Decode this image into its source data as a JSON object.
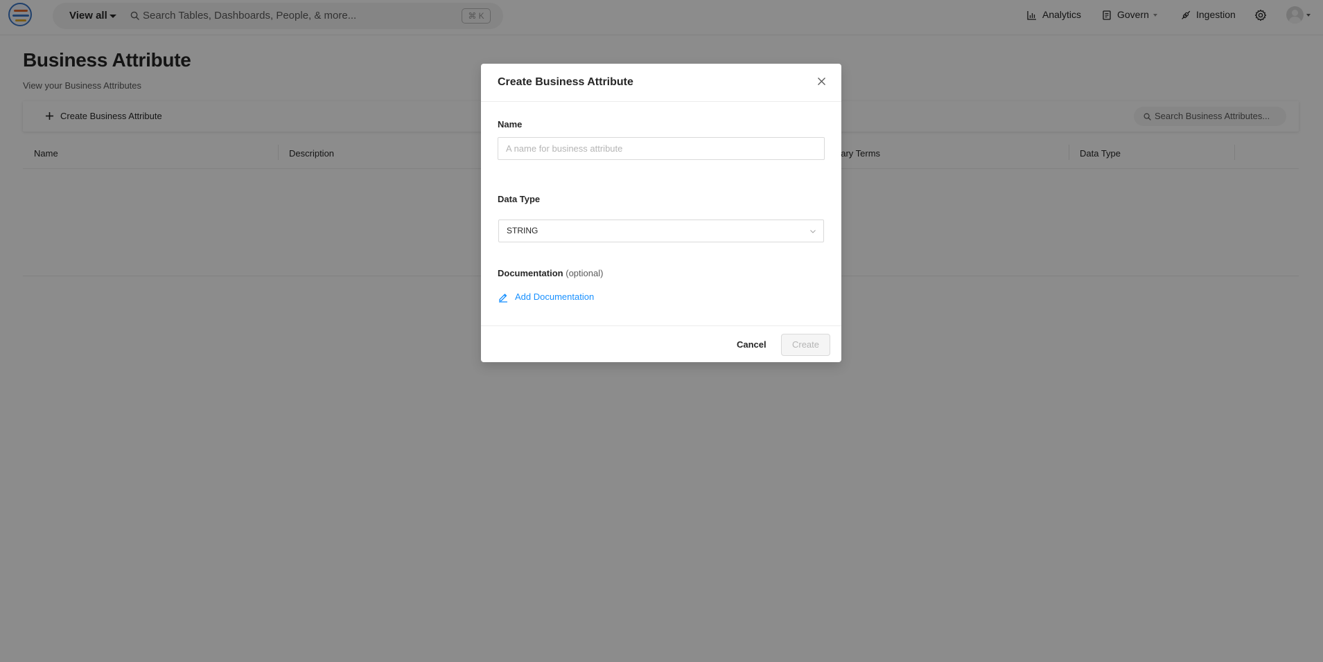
{
  "header": {
    "view_all": "View all",
    "search_placeholder": "Search Tables, Dashboards, People, & more...",
    "shortcut": "⌘ K",
    "nav": [
      {
        "label": "Analytics"
      },
      {
        "label": "Govern"
      },
      {
        "label": "Ingestion"
      }
    ]
  },
  "page": {
    "title": "Business Attribute",
    "subtitle": "View your Business Attributes",
    "create_label": "Create Business Attribute",
    "search_placeholder": "Search Business Attributes...",
    "columns": [
      "Name",
      "Description",
      "Glossary Terms",
      "Data Type"
    ]
  },
  "modal": {
    "title": "Create Business Attribute",
    "name_label": "Name",
    "name_placeholder": "A name for business attribute",
    "name_value": "",
    "data_type_label": "Data Type",
    "data_type_value": "STRING",
    "documentation_label": "Documentation",
    "documentation_optional": "(optional)",
    "add_documentation": "Add Documentation",
    "cancel": "Cancel",
    "create": "Create"
  },
  "colors": {
    "accent": "#1890ff",
    "overlay": "#000000"
  }
}
